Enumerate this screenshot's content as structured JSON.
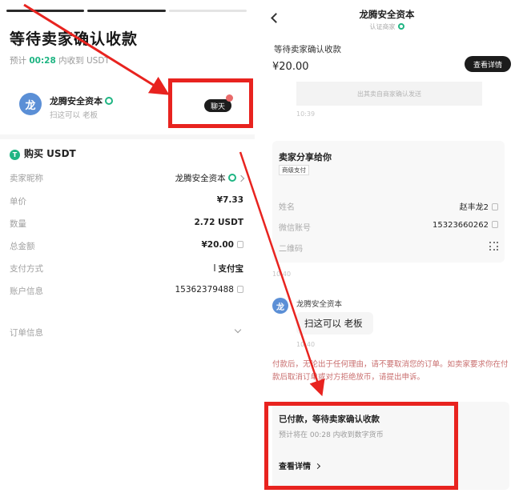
{
  "left": {
    "title": "等待卖家确认收款",
    "sub_prefix": "预计",
    "sub_time": "00:28",
    "sub_suffix": "内收到 USDT",
    "merchant": {
      "avatar_text": "龙",
      "name": "龙腾安全资本",
      "subtitle": "扫这可以 老板"
    },
    "chat_label": "聊天",
    "buy_label": "购买 USDT",
    "buy_icon": "T",
    "rows": [
      {
        "key": "卖家昵称",
        "value": "龙腾安全资本"
      },
      {
        "key": "单价",
        "value": "¥7.33"
      },
      {
        "key": "数量",
        "value": "2.72 USDT"
      },
      {
        "key": "总金额",
        "value": "¥20.00"
      },
      {
        "key": "支付方式",
        "value": "支付宝"
      },
      {
        "key": "账户信息",
        "value": "15362379488"
      }
    ],
    "order_info": "订单信息"
  },
  "right": {
    "header_title": "龙腾安全资本",
    "header_sub": "认证商家",
    "status": "等待卖家确认收款",
    "amount": "¥20.00",
    "detail_btn": "查看详情",
    "system_msg": "出其卖自商家确认发送",
    "time_1": "10:39",
    "share": {
      "title": "卖家分享给你",
      "tag": "商级支付",
      "rows": [
        {
          "key": "姓名",
          "value": "赵丰龙2"
        },
        {
          "key": "微信账号",
          "value": "15323660262"
        },
        {
          "key": "二维码",
          "value": ""
        }
      ]
    },
    "time_2": "10:40",
    "msg_avatar": "龙",
    "msg_name": "龙腾安全资本",
    "msg_text": "扫这可以 老板",
    "time_3": "10:40",
    "warning": "付款后，无论出于任何理由，请不要取消您的订单。如卖家要求你在付款后取消订单或对方拒绝放币，请提出申诉。",
    "paid": {
      "title": "已付款，等待卖家确认收款",
      "sub": "预计将在 00:28 内收到数字货币",
      "link": "查看详情"
    }
  },
  "colors": {
    "accent_green": "#1fb583",
    "annotation_red": "#e8231f",
    "dark_button": "#1c1c1c",
    "warning_text": "#c96e6e"
  }
}
